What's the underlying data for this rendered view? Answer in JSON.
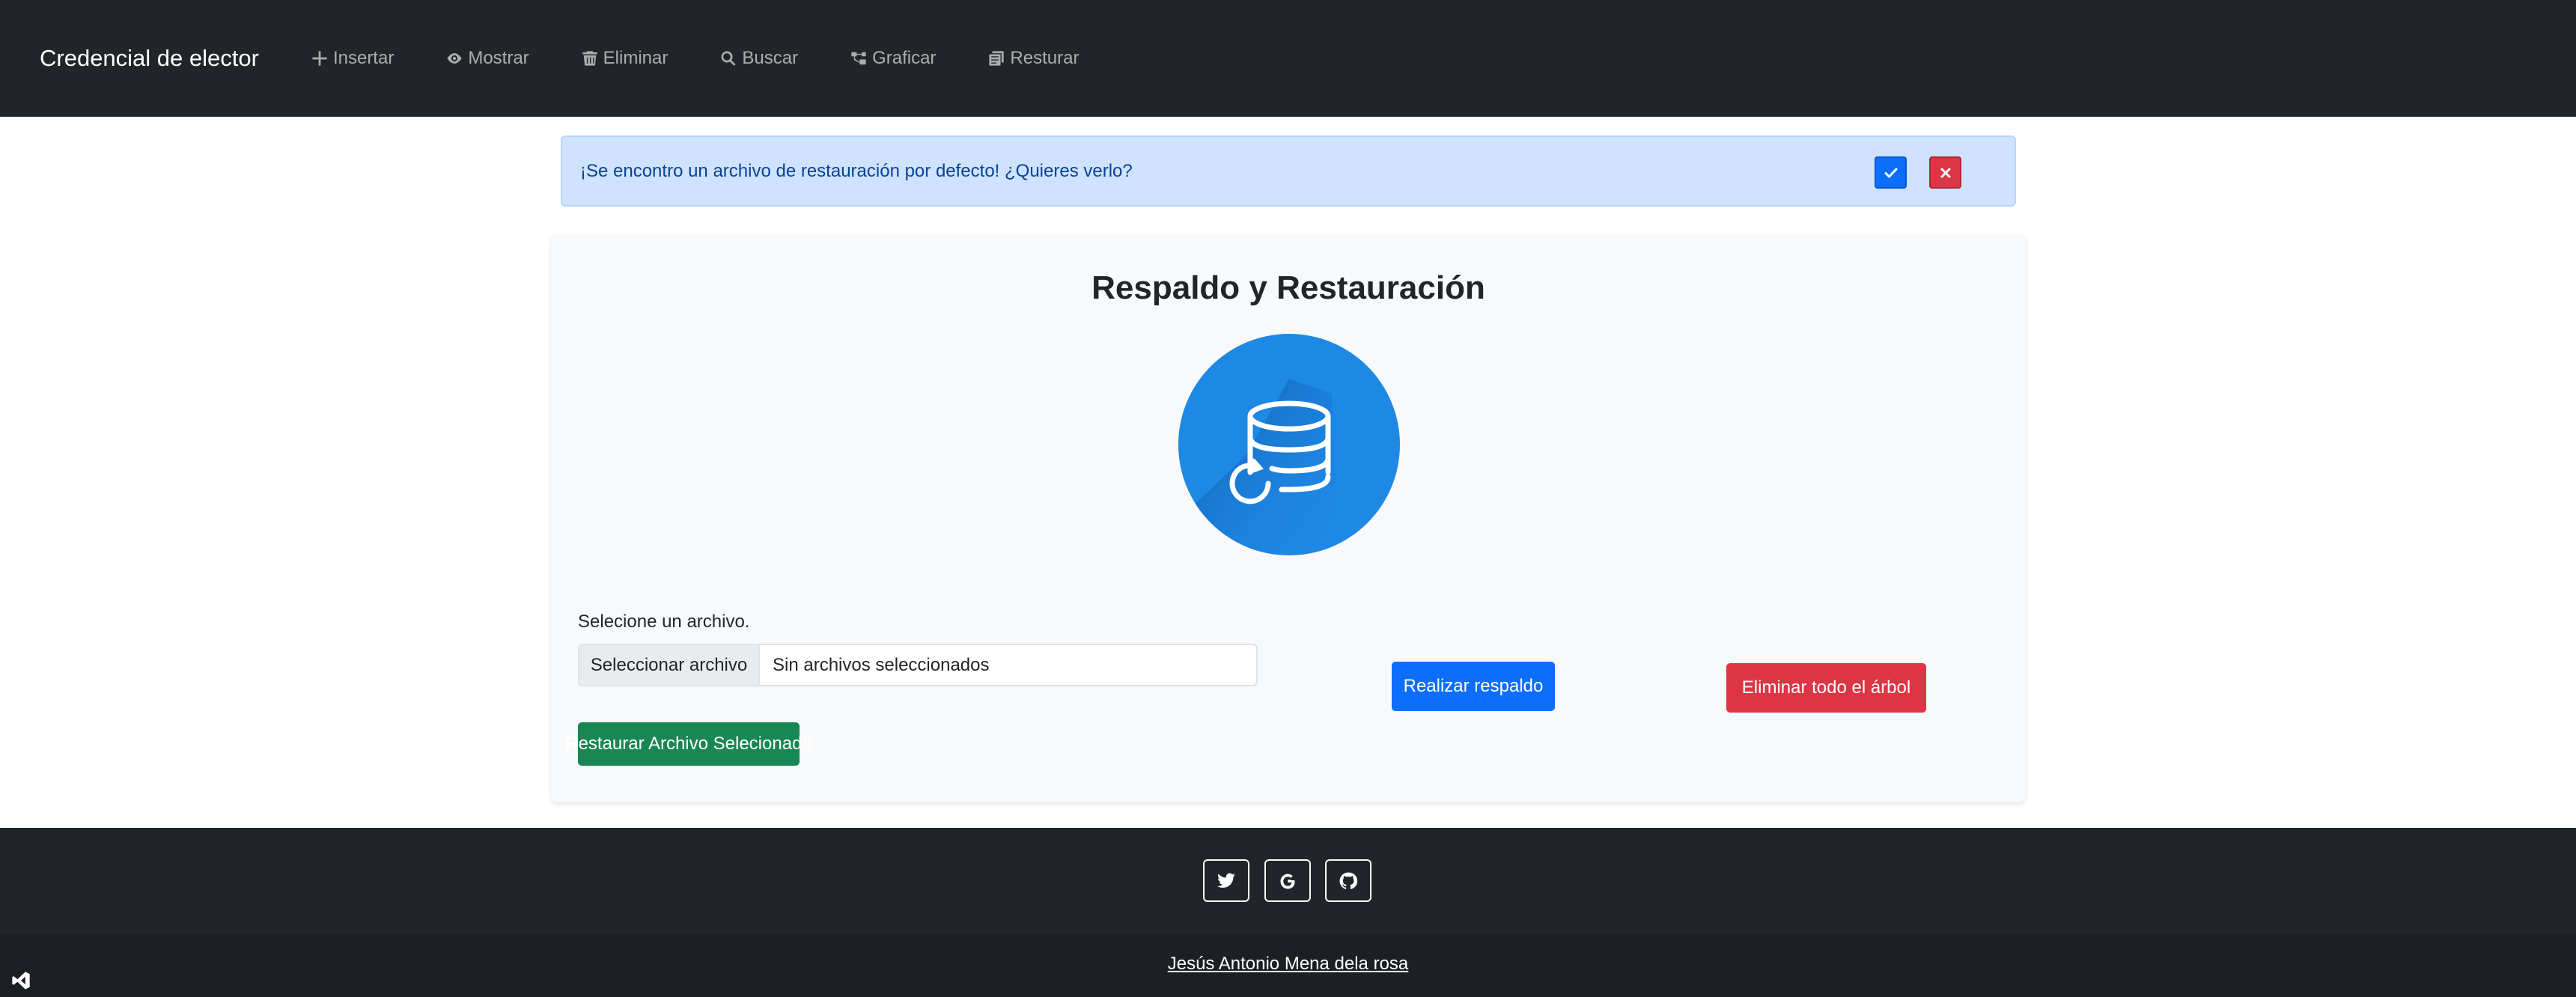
{
  "navbar": {
    "brand": "Credencial de elector",
    "items": [
      {
        "label": "Insertar",
        "icon": "plus-icon"
      },
      {
        "label": "Mostrar",
        "icon": "eye-icon"
      },
      {
        "label": "Eliminar",
        "icon": "trash-icon"
      },
      {
        "label": "Buscar",
        "icon": "search-icon"
      },
      {
        "label": "Graficar",
        "icon": "diagram-icon"
      },
      {
        "label": "Resturar",
        "icon": "files-icon"
      }
    ]
  },
  "alert": {
    "message": "¡Se encontro un archivo de restauración por defecto! ¿Quieres verlo?",
    "confirm_icon": "check-icon",
    "dismiss_icon": "close-icon"
  },
  "card": {
    "title": "Respaldo y Restauración",
    "icon": "database-restore-icon",
    "file_label": "Selecione un archivo.",
    "file_button": "Seleccionar archivo",
    "file_status": "Sin archivos seleccionados",
    "restore_button": "Restaurar Archivo Selecionado",
    "backup_button": "Realizar respaldo",
    "delete_button": "Eliminar todo el árbol"
  },
  "footer": {
    "social": [
      "twitter-icon",
      "google-icon",
      "github-icon"
    ],
    "author": "Jesús Antonio Mena dela rosa"
  },
  "colors": {
    "navbar_bg": "#212529",
    "alert_bg": "#cfe2ff",
    "primary": "#0d6efd",
    "danger": "#dc3545",
    "success": "#198754",
    "icon_blue": "#1e88e5"
  }
}
